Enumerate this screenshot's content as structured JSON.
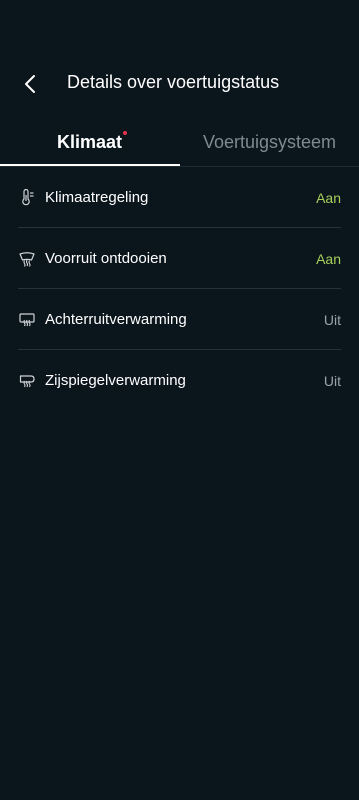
{
  "header": {
    "title": "Details over voertuigstatus",
    "back_icon": "chevron-left-icon"
  },
  "tabs": [
    {
      "label": "Klimaat",
      "active": true,
      "notification_dot": true
    },
    {
      "label": "Voertuigsysteem",
      "active": false,
      "notification_dot": false
    }
  ],
  "climate_items": [
    {
      "label": "Klimaatregeling",
      "value": "Aan",
      "icon": "thermometer-icon"
    },
    {
      "label": "Voorruit ontdooien",
      "value": "Aan",
      "icon": "windshield-defrost-icon"
    },
    {
      "label": "Achterruitverwarming",
      "value": "Uit",
      "icon": "rear-window-heating-icon"
    },
    {
      "label": "Zijspiegelverwarming",
      "value": "Uit",
      "icon": "mirror-heating-icon"
    }
  ],
  "colors": {
    "background": "#0b151c",
    "value_on": "#a7d05a",
    "value_off": "#9aa3a9",
    "notification_dot": "#e5334b",
    "text_primary": "#ffffff",
    "text_inactive": "#7f8990"
  }
}
